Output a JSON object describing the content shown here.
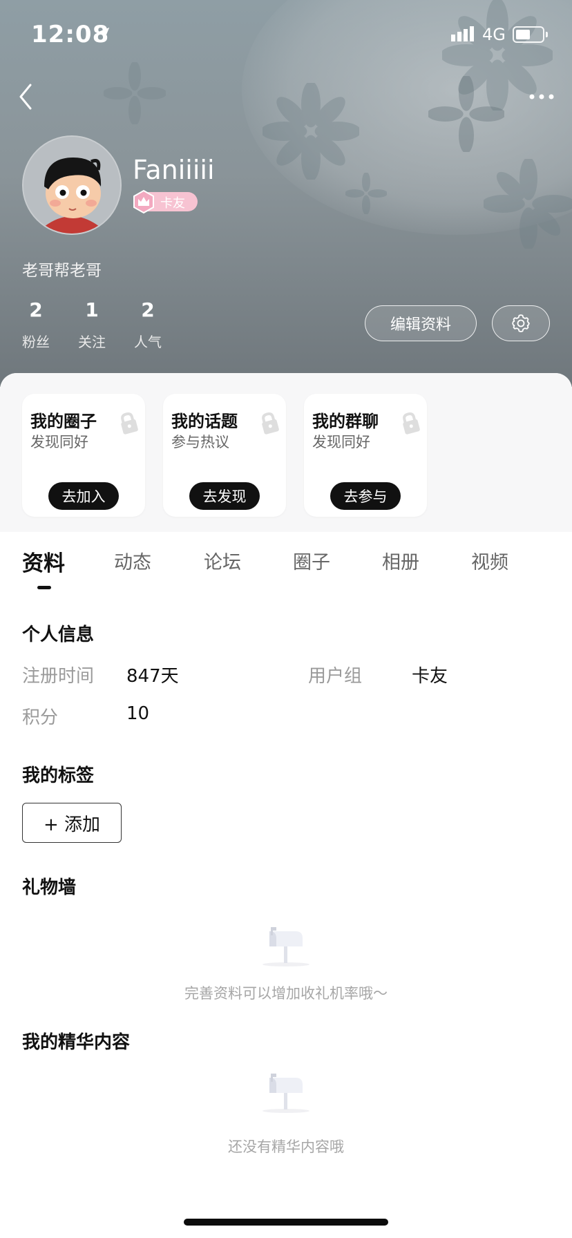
{
  "status_bar": {
    "time": "12:08",
    "network": "4G"
  },
  "profile": {
    "username": "Faniiiii",
    "badge": "卡友",
    "bio": "老哥帮老哥",
    "stats": [
      {
        "value": "2",
        "label": "粉丝"
      },
      {
        "value": "1",
        "label": "关注"
      },
      {
        "value": "2",
        "label": "人气"
      }
    ],
    "edit_label": "编辑资料"
  },
  "cards": [
    {
      "title": "我的圈子",
      "subtitle": "发现同好",
      "button": "去加入"
    },
    {
      "title": "我的话题",
      "subtitle": "参与热议",
      "button": "去发现"
    },
    {
      "title": "我的群聊",
      "subtitle": "发现同好",
      "button": "去参与"
    }
  ],
  "tabs": [
    "资料",
    "动态",
    "论坛",
    "圈子",
    "相册",
    "视频"
  ],
  "active_tab": "资料",
  "personal_info": {
    "title": "个人信息",
    "register_label": "注册时间",
    "register_value": "847天",
    "group_label": "用户组",
    "group_value": "卡友",
    "points_label": "积分",
    "points_value": "10"
  },
  "tags": {
    "title": "我的标签",
    "add_label": "+ 添加"
  },
  "gift_wall": {
    "title": "礼物墙",
    "empty_text": "完善资料可以增加收礼机率哦～"
  },
  "featured": {
    "title": "我的精华内容",
    "empty_text": "还没有精华内容哦"
  },
  "colors": {
    "badge_pink": "#f7c3d2",
    "header_gray": "#8a9499",
    "button_black": "#111111"
  }
}
